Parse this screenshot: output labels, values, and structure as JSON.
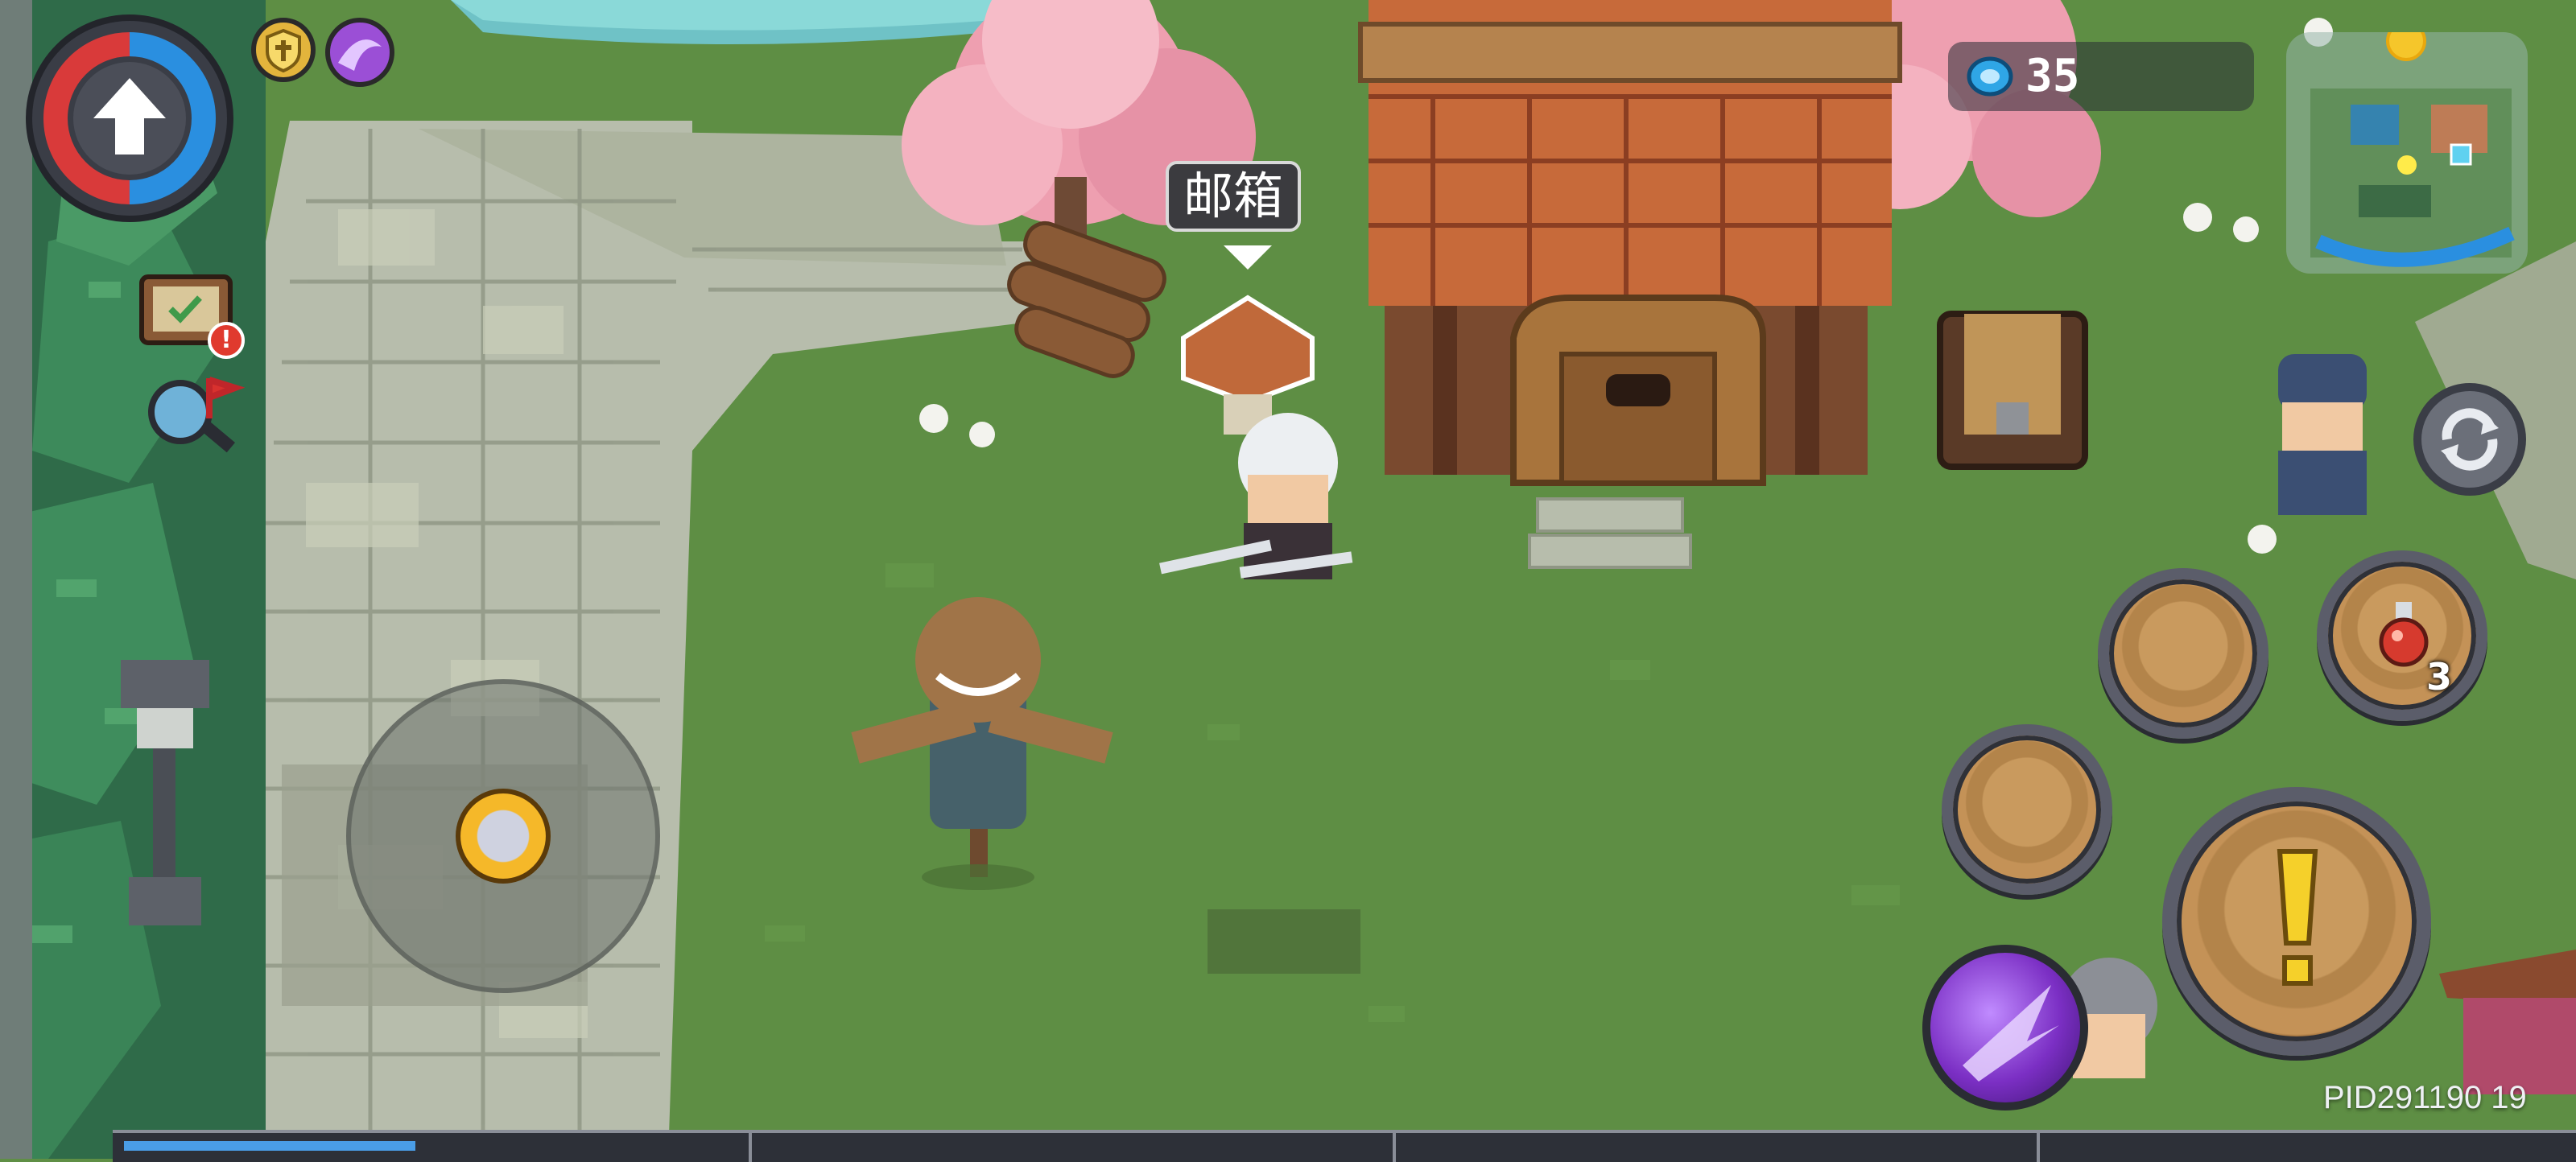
{
  "hud": {
    "mailbox_label": "邮箱",
    "currency": {
      "value": "35",
      "icon": "gem-icon"
    },
    "potion_count": "3",
    "pid_text": "PID291190 19",
    "health_ring": {
      "red_fraction": 0.5,
      "blue_fraction": 0.5
    },
    "progress_bar": {
      "fill_fraction": 0.12
    }
  },
  "buffs": [
    {
      "name": "shield-buff-icon",
      "color": "#e3b43c"
    },
    {
      "name": "purple-skill-buff-icon",
      "color": "#9b4fd6"
    }
  ],
  "colors": {
    "grass": "#5f8f45",
    "stone": "#b9bfb0",
    "roof": "#c76a3a",
    "blossom": "#f2a7b6",
    "accent_gold": "#f2c230",
    "skill_purple": "#7b2fc4"
  }
}
